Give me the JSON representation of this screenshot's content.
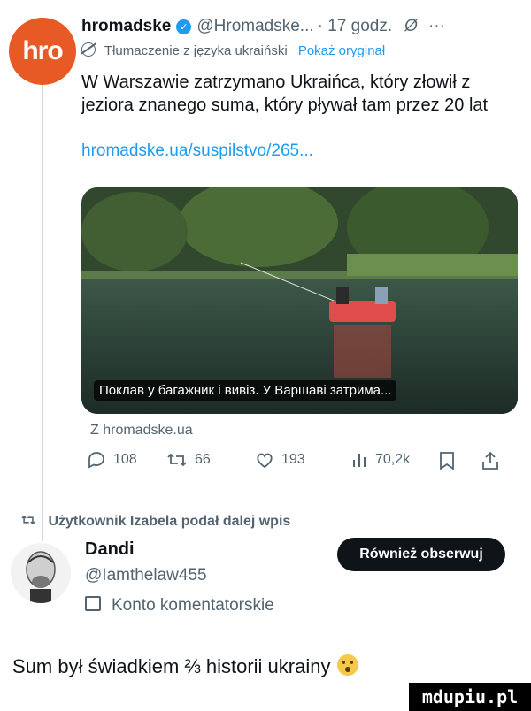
{
  "tweet": {
    "avatar_text": "hro",
    "author_name": "hromadske",
    "author_handle": "@Hromadske...",
    "time": "· 17 godz.",
    "more": "···",
    "translated_label": "Tłumaczenie z języka ukraiński",
    "show_original": "Pokaż oryginał",
    "text": "W Warszawie zatrzymano Ukraińca, który złowił z jeziora znanego suma, który pływał tam przez 20 lat",
    "link": "hromadske.ua/suspilstvo/265...",
    "media_caption": "Поклав у багажник і вивіз. У Варшаві затрима...",
    "source": "Z hromadske.ua",
    "stats": {
      "replies": "108",
      "retweets": "66",
      "likes": "193",
      "views": "70,2k"
    }
  },
  "retweet_note": "Użytkownik Izabela podał dalej wpis",
  "user": {
    "name": "Dandi",
    "handle": "@Iamthelaw455",
    "account_type": "Konto komentatorskie",
    "follow_label": "Również obserwuj"
  },
  "comment": "Sum był świadkiem ⅔ historii ukrainy",
  "watermark": "mdupiu.pl",
  "colors": {
    "accent": "#1d9bf0",
    "brand": "#e85a25",
    "text": "#0f1419",
    "muted": "#536471"
  }
}
